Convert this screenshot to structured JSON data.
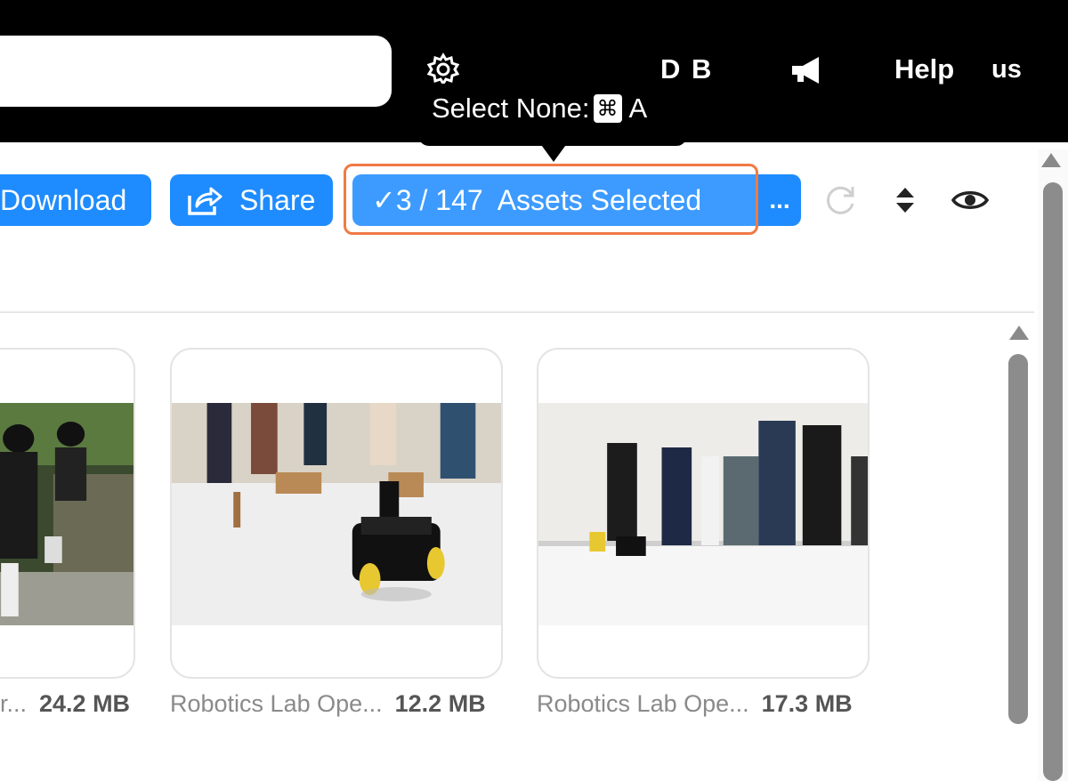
{
  "header": {
    "user_initials": "D B",
    "help_label": "Help",
    "language_label": "us",
    "icons": [
      "gear-icon",
      "megaphone-icon"
    ]
  },
  "tooltip": {
    "text": "Select None:",
    "key_symbol": "⌘",
    "key_letter": "A"
  },
  "toolbar": {
    "download_label": "Download",
    "share_label": "Share",
    "selection_label": "✓3 / 147  Assets Selected",
    "more_label": "...",
    "icons": [
      "share-icon",
      "refresh-icon",
      "sort-icon",
      "eye-icon"
    ]
  },
  "colors": {
    "primary_button": "#1e8cff",
    "selected_button": "#3d9bff",
    "highlight_border": "#f07a45",
    "header_bg": "#000000"
  },
  "assets": [
    {
      "name": "r...",
      "size": "24.2 MB"
    },
    {
      "name": "Robotics Lab Ope...",
      "size": "12.2 MB"
    },
    {
      "name": "Robotics Lab Ope...",
      "size": "17.3 MB"
    }
  ]
}
